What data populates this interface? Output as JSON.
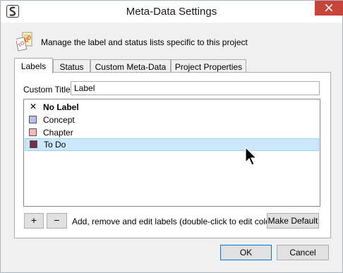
{
  "window": {
    "title": "Meta-Data Settings"
  },
  "header": {
    "text": "Manage the label and status lists specific to this project",
    "icon": "tags-icon"
  },
  "tabs": [
    {
      "label": "Labels",
      "active": true
    },
    {
      "label": "Status",
      "active": false
    },
    {
      "label": "Custom Meta-Data",
      "active": false
    },
    {
      "label": "Project Properties",
      "active": false
    }
  ],
  "custom_title": {
    "label": "Custom Title:",
    "value": "Label"
  },
  "labels_list": [
    {
      "name": "No Label",
      "color": null,
      "bold": true,
      "selected": false
    },
    {
      "name": "Concept",
      "color": "#b9bdf0",
      "bold": false,
      "selected": false
    },
    {
      "name": "Chapter",
      "color": "#f5b8b8",
      "bold": false,
      "selected": false
    },
    {
      "name": "To Do",
      "color": "#7a2b48",
      "bold": false,
      "selected": true
    }
  ],
  "list_toolbar": {
    "add_label": "+",
    "remove_label": "−",
    "hint": "Add, remove and edit labels (double-click to edit colors).",
    "make_default_label": "Make Default"
  },
  "footer": {
    "ok_label": "OK",
    "cancel_label": "Cancel"
  }
}
